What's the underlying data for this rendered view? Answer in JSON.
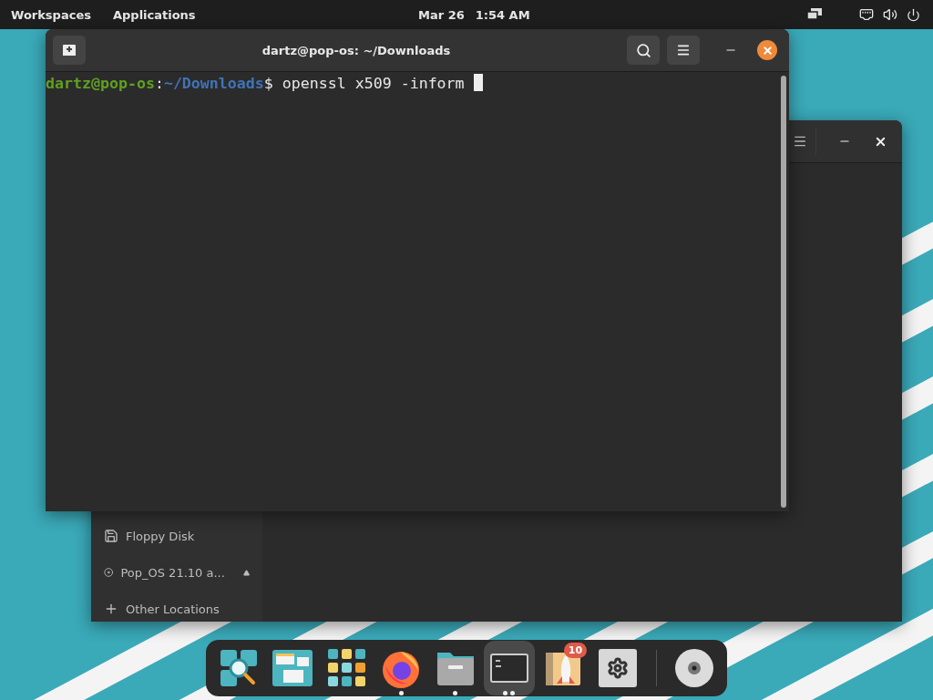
{
  "top_bar": {
    "menus": [
      {
        "label": "Workspaces"
      },
      {
        "label": "Applications"
      }
    ],
    "date": "Mar 26",
    "time": "1:54 AM"
  },
  "terminal": {
    "title": "dartz@pop-os: ~/Downloads",
    "prompt": {
      "user_host": "dartz@pop-os",
      "separator": ":",
      "path": "~/Downloads",
      "symbol": "$",
      "command": " openssl x509 -inform "
    }
  },
  "files_window": {
    "sidebar": [
      {
        "kind": "floppy",
        "label": "Floppy Disk",
        "ejectable": false
      },
      {
        "kind": "disc",
        "label": "Pop_OS 21.10 a...",
        "ejectable": true
      },
      {
        "kind": "add",
        "label": "Other Locations",
        "ejectable": false
      }
    ]
  },
  "dock": [
    {
      "kind": "search",
      "running": false,
      "selected": false
    },
    {
      "kind": "workspaces",
      "running": false,
      "selected": false
    },
    {
      "kind": "apps",
      "running": false,
      "selected": false
    },
    {
      "kind": "firefox",
      "running": true,
      "multiple_windows": false,
      "selected": false
    },
    {
      "kind": "files",
      "running": true,
      "multiple_windows": false,
      "selected": false
    },
    {
      "kind": "terminal",
      "running": true,
      "multiple_windows": true,
      "selected": true
    },
    {
      "kind": "shop",
      "running": false,
      "selected": false,
      "badge": "10"
    },
    {
      "kind": "settings",
      "running": false,
      "selected": false
    },
    {
      "kind": "divider"
    },
    {
      "kind": "disc",
      "running": false,
      "selected": false
    }
  ]
}
